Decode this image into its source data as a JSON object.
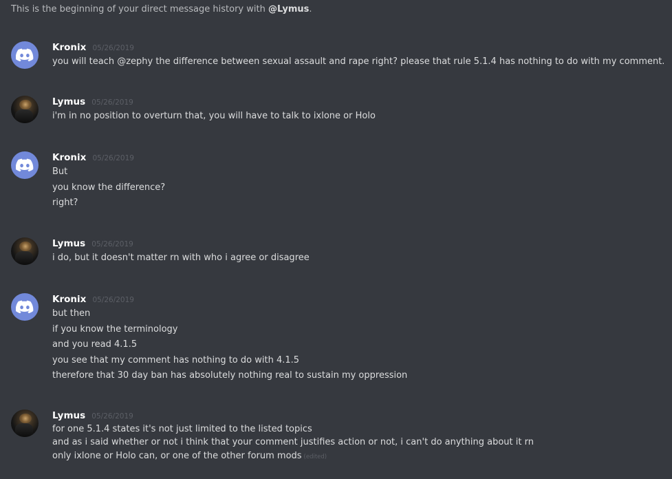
{
  "intro": {
    "prefix": "This is the beginning of your direct message history with ",
    "user": "@Lymus",
    "suffix": "."
  },
  "messages": [
    {
      "author": "Kronix",
      "timestamp": "05/26/2019",
      "avatar": "discord-logo-icon",
      "lines": [
        "you will teach @zephy the difference between sexual assault and rape right? please that rule 5.1.4 has nothing to do with my comment."
      ]
    },
    {
      "author": "Lymus",
      "timestamp": "05/26/2019",
      "avatar": "user-photo-avatar",
      "lines": [
        "i'm in no position to overturn that, you will have to talk to ixlone or Holo"
      ]
    },
    {
      "author": "Kronix",
      "timestamp": "05/26/2019",
      "avatar": "discord-logo-icon",
      "lines": [
        "But",
        "you know the difference?",
        "right?"
      ]
    },
    {
      "author": "Lymus",
      "timestamp": "05/26/2019",
      "avatar": "user-photo-avatar",
      "lines": [
        "i do, but it doesn't matter rn with who i agree or disagree"
      ]
    },
    {
      "author": "Kronix",
      "timestamp": "05/26/2019",
      "avatar": "discord-logo-icon",
      "lines": [
        "but then",
        "if you know the terminology",
        "and you read 4.1.5",
        "you see that my comment has nothing to do with 4.1.5",
        "therefore that 30 day ban has absolutely nothing real to sustain my oppression"
      ]
    },
    {
      "author": "Lymus",
      "timestamp": "05/26/2019",
      "avatar": "user-photo-avatar",
      "lines": [
        "for one 5.1.4 states it's not just limited to the listed topics",
        "and as i said whether or not i think that your comment justifies action or not, i can't do anything about it rn",
        "only ixlone or Holo can, or one of the other forum mods"
      ],
      "edited_label": "(edited)"
    }
  ],
  "colors": {
    "background": "#36393f",
    "discord_blurple": "#7289da",
    "username": "#ffffff",
    "text": "#dcddde",
    "timestamp": "#5c5f66"
  }
}
